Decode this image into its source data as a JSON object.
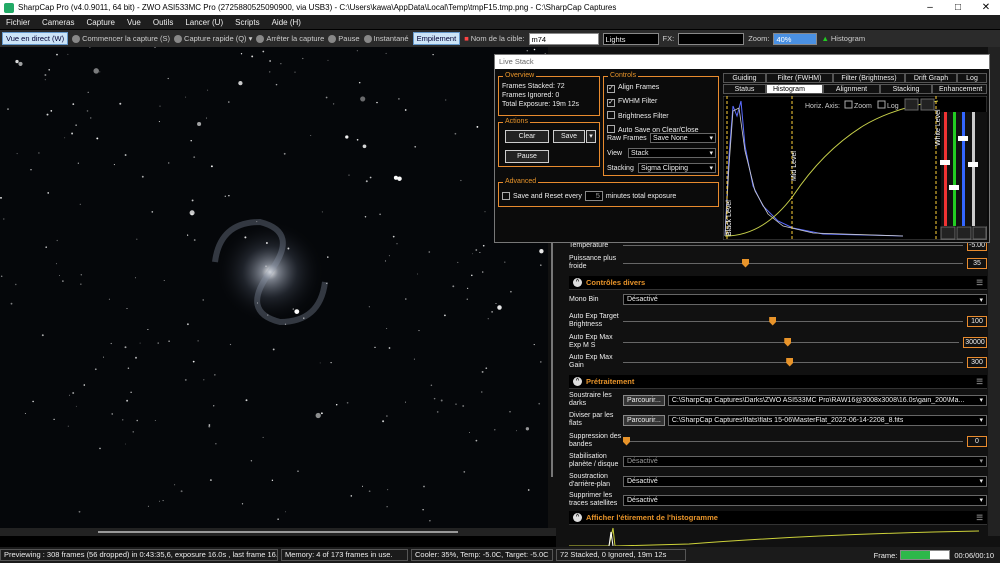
{
  "window": {
    "title": "SharpCap Pro (v4.0.9011, 64 bit) - ZWO ASI533MC Pro (2725880525090900, via USB3) - C:\\Users\\kawa\\AppData\\Local\\Temp\\tmpF15.tmp.png - C:\\SharpCap Captures"
  },
  "menu": [
    "Fichier",
    "Cameras",
    "Capture",
    "Vue",
    "Outils",
    "Lancer (U)",
    "Scripts",
    "Aide (H)"
  ],
  "toolbar": {
    "live": "Vue en direct (W)",
    "start_capture": "Commencer la capture (S)",
    "quick_capture": "Capture rapide (Q)",
    "stop_capture": "Arrêter la capture",
    "pause": "Pause",
    "snapshot": "Instantané",
    "stacking": "Empilement",
    "target_label": "Nom de la cible:",
    "target_value": "m74",
    "frame_type": "Lights",
    "fx_label": "FX:",
    "fx_value": "",
    "zoom_label": "Zoom:",
    "zoom_value": "40%",
    "histogram_label": "Histogram"
  },
  "live_stack": {
    "title": "Live Stack",
    "overview": {
      "title": "Overview",
      "frames_stacked_label": "Frames Stacked:",
      "frames_stacked": "72",
      "frames_ignored_label": "Frames Ignored:",
      "frames_ignored": "0",
      "total_exposure_label": "Total Exposure:",
      "total_exposure": "19m 12s"
    },
    "actions": {
      "title": "Actions",
      "clear": "Clear",
      "save": "Save",
      "pause": "Pause"
    },
    "controls": {
      "title": "Controls",
      "align_frames": "Align Frames",
      "fwhm_filter": "FWHM Filter",
      "brightness_filter": "Brightness Filter",
      "auto_save": "Auto Save on Clear/Close",
      "raw_frames_label": "Raw Frames",
      "raw_frames_value": "Save None",
      "view_label": "View",
      "view_value": "Stack",
      "stacking_label": "Stacking",
      "stacking_value": "Sigma Clipping"
    },
    "advanced": {
      "title": "Advanced",
      "save_reset": "Save and Reset every",
      "minutes_value": "5",
      "minutes_label": "minutes total exposure"
    },
    "tabs_top": [
      "Guiding",
      "Filter (FWHM)",
      "Filter (Brightness)",
      "Drift Graph",
      "Log"
    ],
    "tabs_bottom": [
      "Status",
      "Histogram",
      "Alignment",
      "Stacking",
      "Enhancement"
    ],
    "histogram": {
      "horiz_axis": "Horiz. Axis:",
      "zoom": "Zoom",
      "log": "Log",
      "black_level": "Black Level",
      "mid_level": "Mid Level",
      "white_level": "White Level"
    }
  },
  "panel": {
    "temperature_label": "Température",
    "temperature_value": "-5.00",
    "power_label": "Puissance plus froide",
    "power_value": "35",
    "power_level": 35,
    "misc_title": "Contrôles divers",
    "mono_bin_label": "Mono Bin",
    "mono_bin_value": "Désactivé",
    "ae_target_label": "Auto Exp Target Brightness",
    "ae_target_value": "100",
    "ae_target_level": 0.43,
    "ae_exp_label": "Auto Exp Max Exp M S",
    "ae_exp_value": "30000",
    "ae_exp_level": 0.48,
    "ae_gain_label": "Auto Exp Max Gain",
    "ae_gain_value": "300",
    "ae_gain_level": 0.48,
    "pre_title": "Prétraitement",
    "darks_label": "Soustraire les darks",
    "darks_browse": "Parcourir...",
    "darks_value": "C:\\SharpCap Captures\\Darks\\ZWO ASI533MC Pro\\RAW16@3008x3008\\16.0s\\gain_200\\Ma...",
    "flats_label": "Diviser par les flats",
    "flats_browse": "Parcourir...",
    "flats_value": "C:\\SharpCap Captures\\flats\\flats 15-06\\MasterFlat_2022-06-14-2208_8.fits",
    "banding_label": "Suppression des bandes",
    "banding_value": "0",
    "planet_label": "Stabilisation planète / disque",
    "planet_value": "Désactivé",
    "bg_label": "Soustraction d'arrière-plan",
    "bg_value": "Désactivé",
    "sat_label": "Supprimer les traces satellites",
    "sat_value": "Désactivé",
    "hist_title": "Afficher l'étirement de l'histogramme"
  },
  "status": {
    "preview": "Previewing : 308 frames (56 dropped) in 0:43:35,6, exposure 16.0s , last frame 16.6",
    "memory": "Memory: 4 of 173 frames in use.",
    "cooler": "Cooler: 35%, Temp: -5.0C, Target: -5.0C",
    "stacked": "72 Stacked, 0 Ignored, 19m 12s",
    "frame_label": "Frame:",
    "frame_time": "00:06/00:10",
    "frame_progress": 0.6
  },
  "colors": {
    "accent": "#e8942a"
  }
}
